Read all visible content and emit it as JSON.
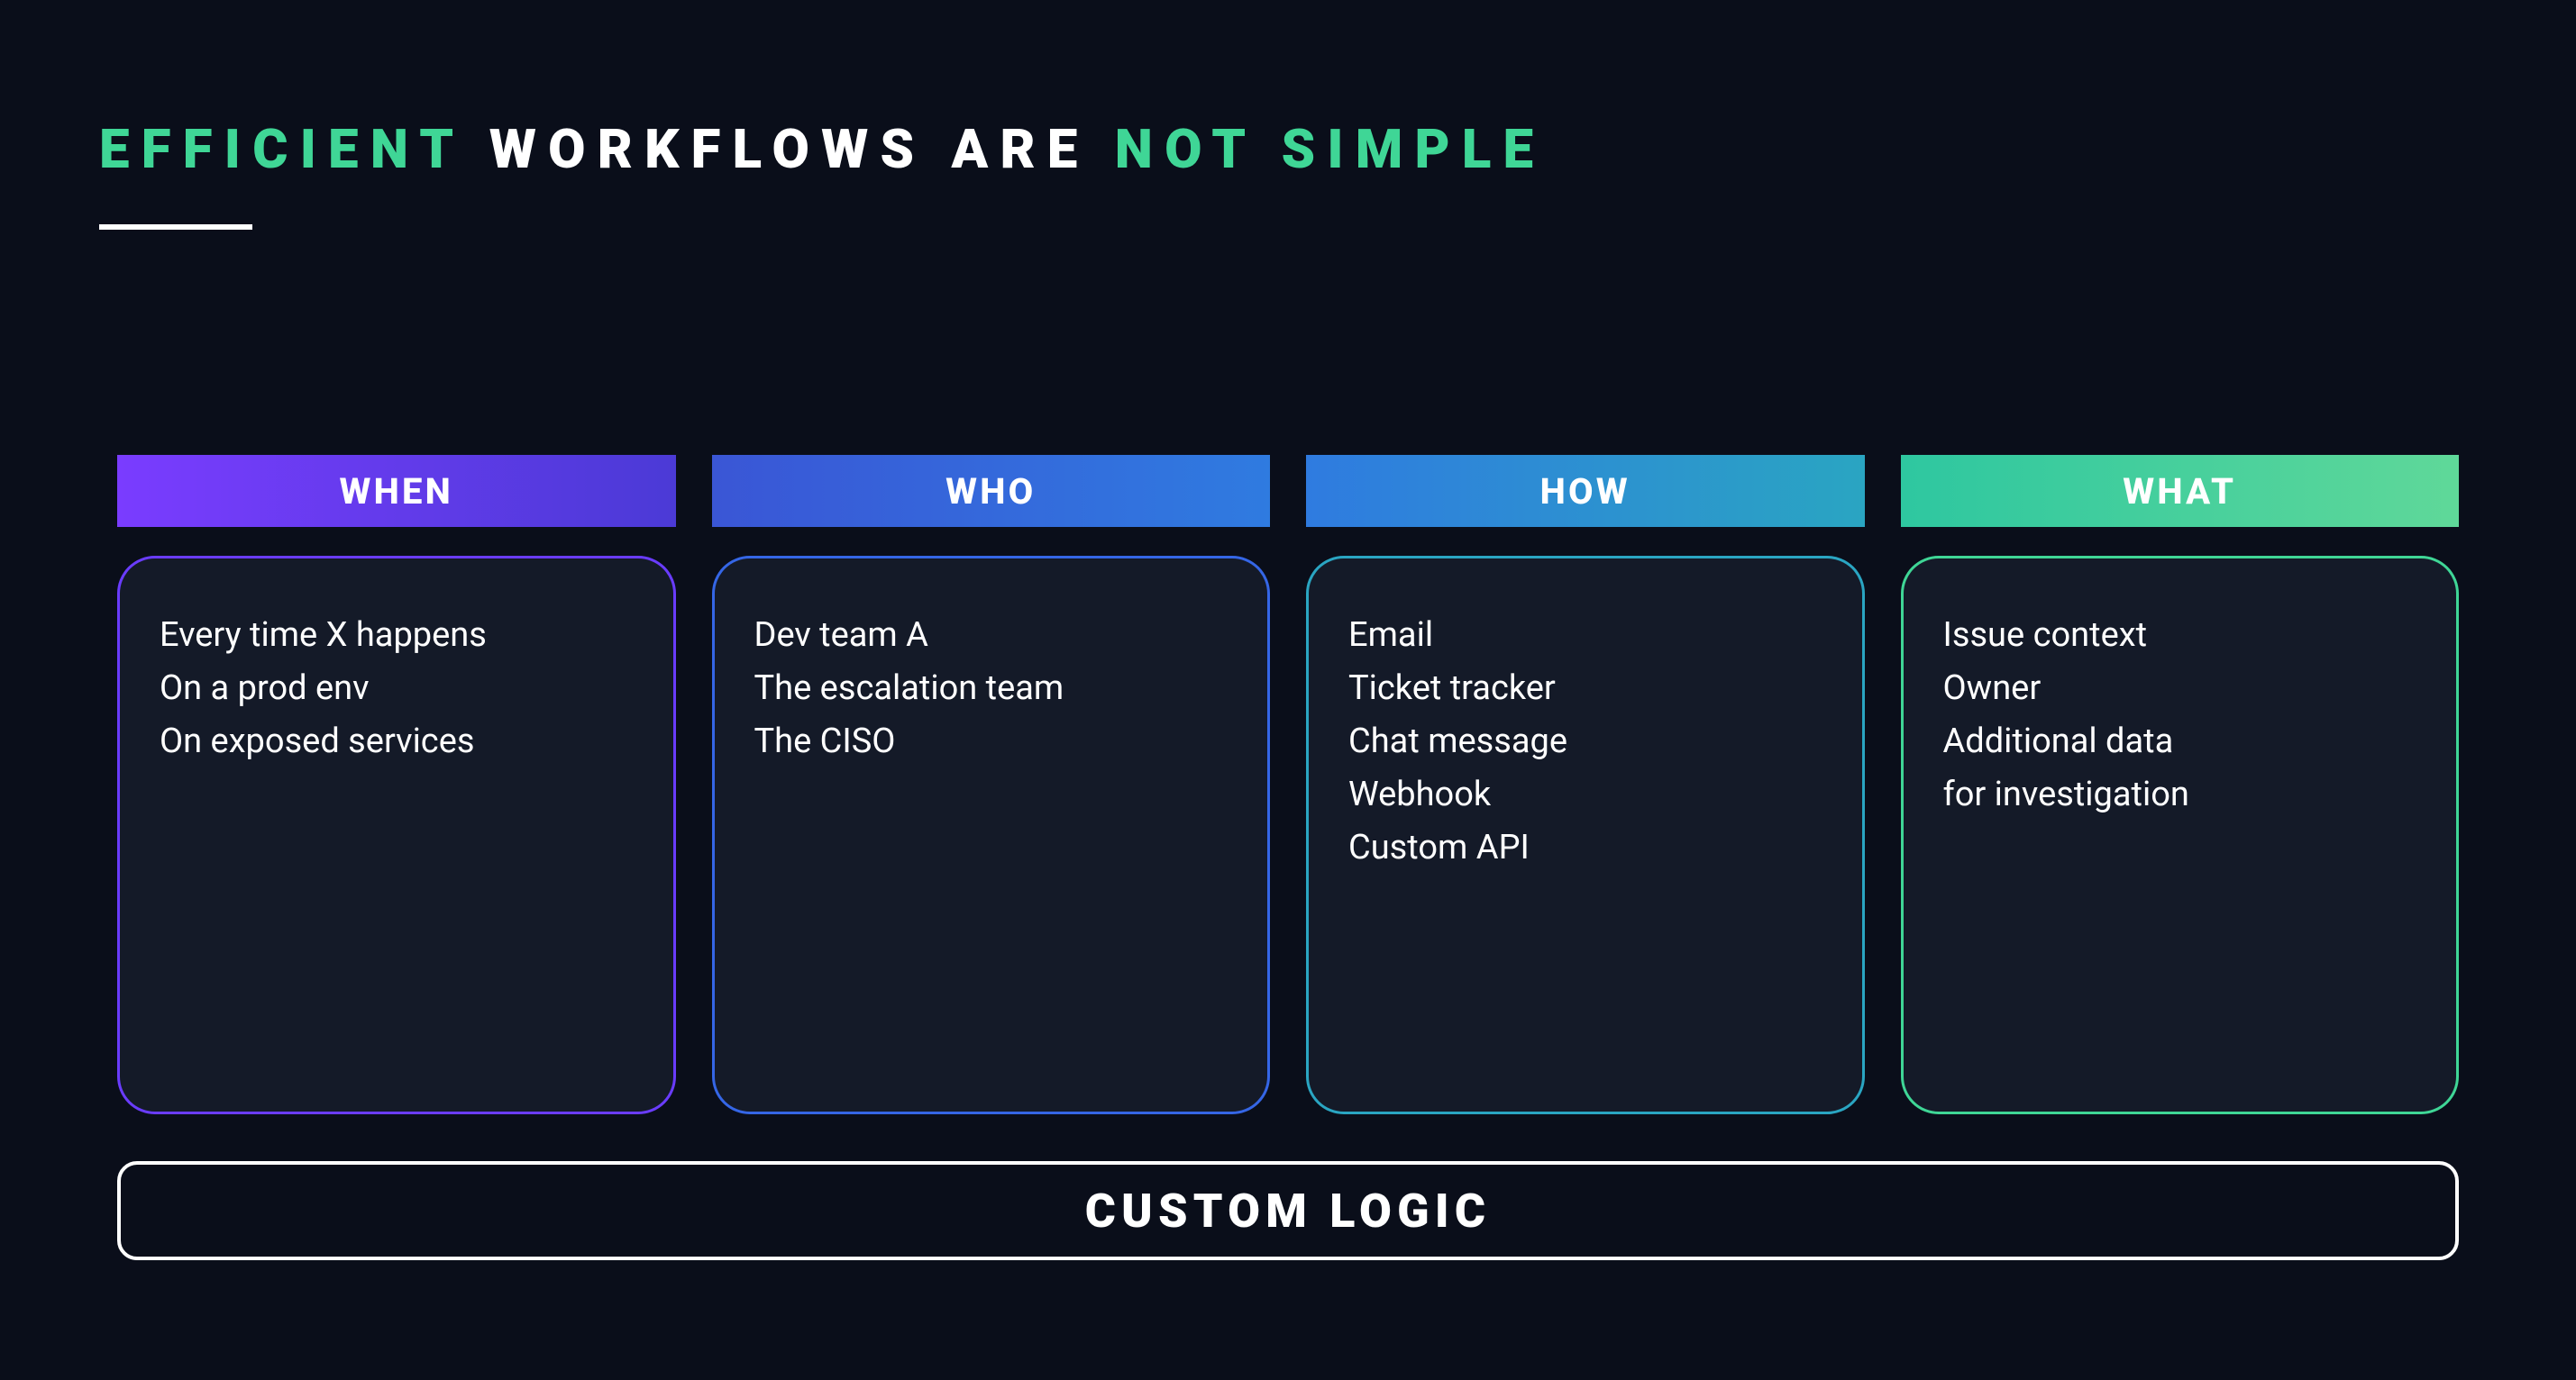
{
  "title": {
    "word1": "EFFICIENT",
    "word2": "WORKFLOWS",
    "word3": "ARE",
    "word4": "NOT",
    "word5": "SIMPLE"
  },
  "columns": {
    "when": {
      "header": "WHEN",
      "items": [
        "Every time X happens",
        "On a prod env",
        "On exposed services"
      ]
    },
    "who": {
      "header": "WHO",
      "items": [
        "Dev team A",
        "The escalation team",
        "The CISO"
      ]
    },
    "how": {
      "header": "HOW",
      "items": [
        "Email",
        "Ticket tracker",
        "Chat message",
        "Webhook",
        "Custom API"
      ]
    },
    "what": {
      "header": "WHAT",
      "items": [
        "Issue context",
        "Owner",
        "Additional data",
        "for investigation"
      ]
    }
  },
  "footer": "CUSTOM LOGIC"
}
